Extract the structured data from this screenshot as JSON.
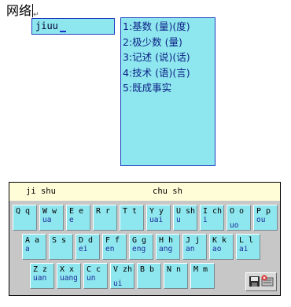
{
  "document": {
    "text": "网络",
    "paragraph_mark": "↵"
  },
  "composition": {
    "text": "jiuu"
  },
  "candidates": [
    "1:基数 (量)(度)",
    "2:极少数 (量)",
    "3:记述 (说)(话)",
    "4:技术 (语)(言)",
    "5:既成事实"
  ],
  "keyboard": {
    "header_left": "ji shu",
    "header_right": "chu sh",
    "rows": [
      [
        {
          "k": "Q q",
          "s": ""
        },
        {
          "k": "W w",
          "s": "ua"
        },
        {
          "k": "E e",
          "s": "e"
        },
        {
          "k": "R r",
          "s": ""
        },
        {
          "k": "T t",
          "s": ""
        },
        {
          "k": "Y y",
          "s": "uai"
        },
        {
          "k": "U sh",
          "s": "u"
        },
        {
          "k": "I ch",
          "s": "i"
        },
        {
          "k": "O o",
          "s": "uo",
          "low": true
        },
        {
          "k": "P p",
          "s": "ou"
        }
      ],
      [
        {
          "k": "A a",
          "s": "a"
        },
        {
          "k": "S s",
          "s": ""
        },
        {
          "k": "D d",
          "s": "ei"
        },
        {
          "k": "F f",
          "s": "en"
        },
        {
          "k": "G g",
          "s": "eng"
        },
        {
          "k": "H h",
          "s": "ang"
        },
        {
          "k": "J j",
          "s": "an"
        },
        {
          "k": "K k",
          "s": "ao"
        },
        {
          "k": "L l",
          "s": "ai"
        }
      ],
      [
        {
          "k": "Z z",
          "s": "uan"
        },
        {
          "k": "X x",
          "s": "uang"
        },
        {
          "k": "C c",
          "s": "un"
        },
        {
          "k": "V zh",
          "s": "ui",
          "low": true
        },
        {
          "k": "B b",
          "s": ""
        },
        {
          "k": "N n",
          "s": ""
        },
        {
          "k": "M m",
          "s": ""
        }
      ]
    ],
    "button_icons": [
      "save-icon",
      "keyboard-close-icon"
    ]
  }
}
